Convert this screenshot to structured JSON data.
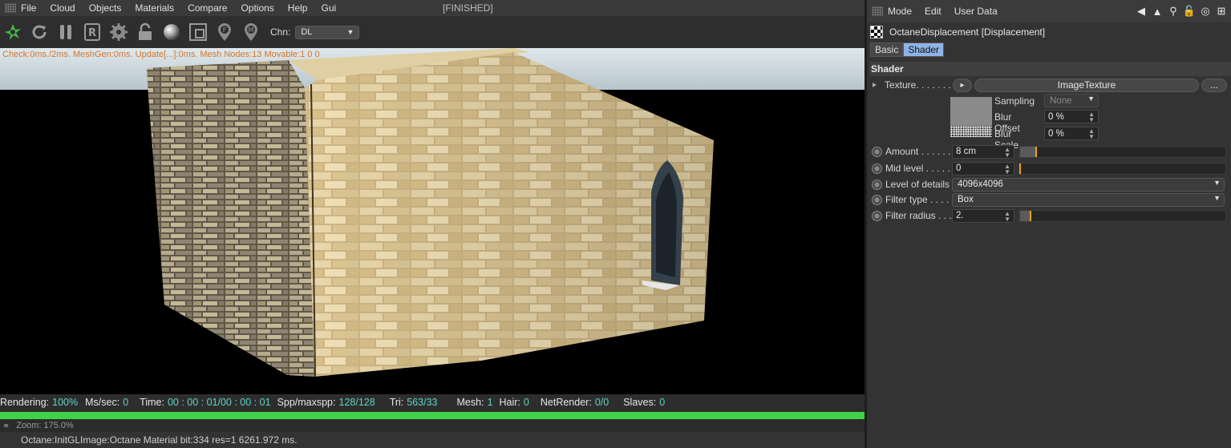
{
  "viewer": {
    "menu": [
      "File",
      "Cloud",
      "Objects",
      "Materials",
      "Compare",
      "Options",
      "Help",
      "Gui"
    ],
    "status_title": "[FINISHED]",
    "channel_label": "Chn:",
    "channel_value": "DL",
    "check_text": "Check:0ms./2ms. MeshGen:0ms. Update[...]:0ms. Mesh Nodes:13 Movable:1  0 0",
    "render_stats": {
      "rendering_label": "Rendering:",
      "rendering_value": "100%",
      "mssec_label": "Ms/sec:",
      "mssec_value": "0",
      "time_label": "Time:",
      "time_value": "00 : 00 : 01/00 : 00 : 01",
      "spp_label": "Spp/maxspp:",
      "spp_value": "128/128",
      "tri_label": "Tri:",
      "tri_value": "563/33",
      "mesh_label": "Mesh:",
      "mesh_value": "1",
      "hair_label": "Hair:",
      "hair_value": "0",
      "netrender_label": "NetRender:",
      "netrender_value": "0/0",
      "slaves_label": "Slaves:",
      "slaves_value": "0"
    },
    "progress_percent": 100,
    "progress_color": "#3fd24a",
    "zoom_text": "Zoom: 175.0%",
    "bottom_status": "Octane:InitGLImage:Octane Material  bit:334 res=1  6261.972 ms.",
    "toolbar_icons": [
      "spinner-icon",
      "refresh-icon",
      "pause-icon",
      "region-render-icon",
      "settings-gear-icon",
      "lock-icon",
      "material-sphere-icon",
      "crop-icon",
      "focus-pin-icon",
      "material-pin-icon"
    ]
  },
  "panel": {
    "menu": [
      "Mode",
      "Edit",
      "User Data"
    ],
    "object_title": "OctaneDisplacement [Displacement]",
    "tabs": [
      {
        "label": "Basic",
        "active": false
      },
      {
        "label": "Shader",
        "active": true
      }
    ],
    "section_title": "Shader",
    "texture": {
      "label": "Texture. . . . . . .",
      "value": "ImageTexture",
      "arrow_label": "▸",
      "more_label": "..."
    },
    "sampling": {
      "label": "Sampling",
      "value": "None"
    },
    "blur_offset": {
      "label": "Blur Offset",
      "value": "0 %"
    },
    "blur_scale": {
      "label": "Blur Scale",
      "value": "0 %"
    },
    "amount": {
      "label": "Amount . . . . . .",
      "value": "8 cm",
      "slider_fraction": 0.08
    },
    "mid_level": {
      "label": "Mid level . . . . .",
      "value": "0",
      "slider_fraction": 0.0
    },
    "level_of_details": {
      "label": "Level of details",
      "value": "4096x4096"
    },
    "filter_type": {
      "label": "Filter type . . . .",
      "value": "Box"
    },
    "filter_radius": {
      "label": "Filter radius . . .",
      "value": "2.",
      "slider_fraction": 0.05
    },
    "accent_color": "#8fb3e6",
    "slider_marker_color": "#f0a020"
  }
}
